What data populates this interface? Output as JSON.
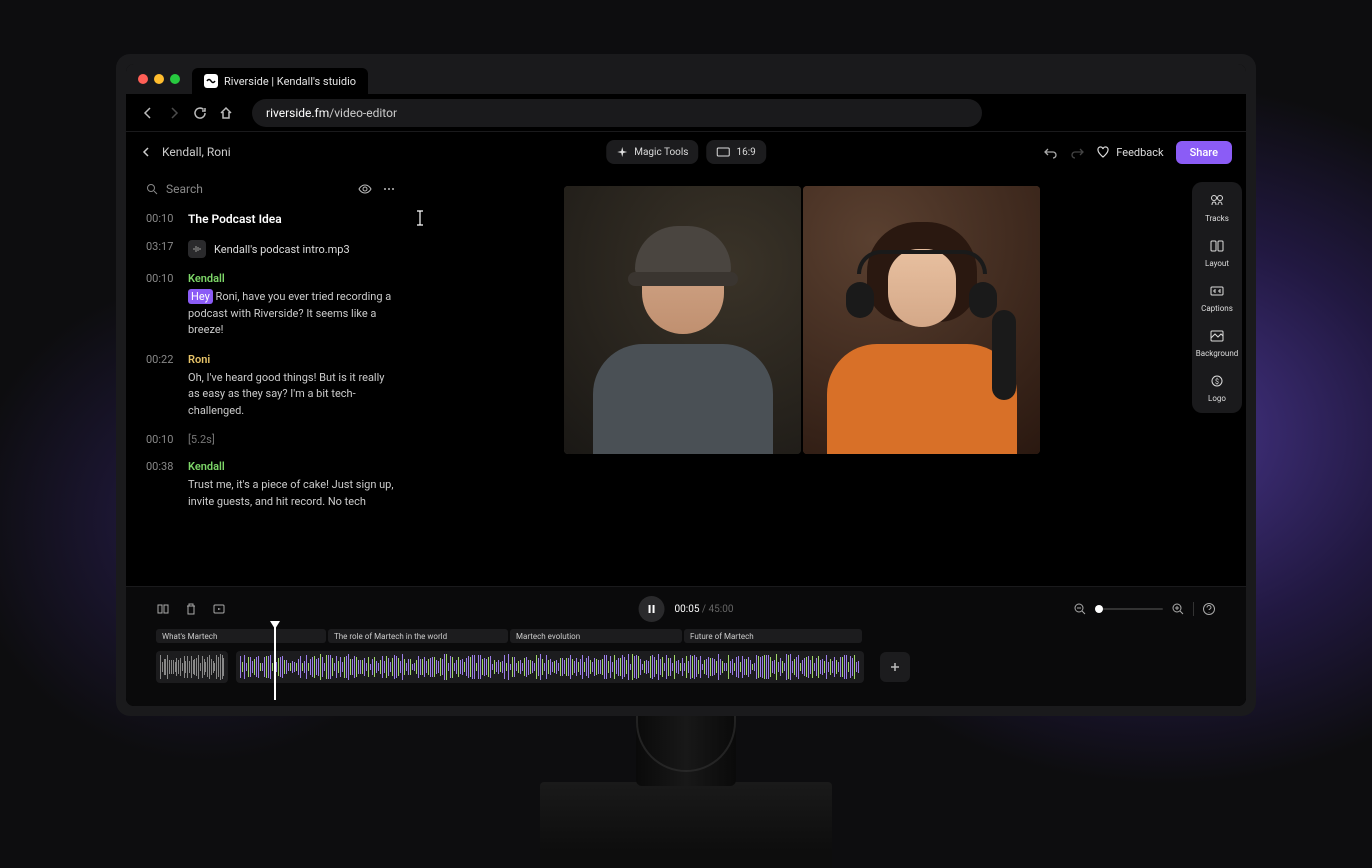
{
  "browser": {
    "tab_title": "Riverside | Kendall's stuidio",
    "url_domain": "riverside.fm",
    "url_path": "/video-editor"
  },
  "header": {
    "breadcrumb": "Kendall, Roni",
    "magic_tools": "Magic Tools",
    "aspect_ratio": "16:9",
    "feedback": "Feedback",
    "share": "Share"
  },
  "sidebar": {
    "items": [
      {
        "label": "Tracks"
      },
      {
        "label": "Layout"
      },
      {
        "label": "Captions"
      },
      {
        "label": "Background"
      },
      {
        "label": "Logo"
      }
    ]
  },
  "search": {
    "placeholder": "Search"
  },
  "transcript": [
    {
      "time": "00:10",
      "type": "title",
      "text": "The Podcast Idea"
    },
    {
      "time": "03:17",
      "type": "file",
      "text": "Kendall's podcast intro.mp3"
    },
    {
      "time": "00:10",
      "type": "speech",
      "speaker": "Kendall",
      "speaker_class": "green",
      "highlight": "Hey",
      "text": " Roni, have you ever tried recording a podcast with Riverside? It seems like a breeze!"
    },
    {
      "time": "00:22",
      "type": "speech",
      "speaker": "Roni",
      "speaker_class": "yellow",
      "text": "Oh, I've heard good things! But is it really as easy as they say? I'm a bit tech-challenged."
    },
    {
      "time": "00:10",
      "type": "gap",
      "text": "[5.2s]"
    },
    {
      "time": "00:38",
      "type": "speech",
      "speaker": "Kendall",
      "speaker_class": "green",
      "text": "Trust me, it's a piece of cake! Just sign up, invite guests, and hit record. No tech"
    }
  ],
  "playback": {
    "current_time": "00:05",
    "total_time": "45:00"
  },
  "timeline": {
    "chapters": [
      {
        "label": "What's Martech"
      },
      {
        "label": "The role of Martech in the world"
      },
      {
        "label": "Martech evolution"
      },
      {
        "label": "Future of Martech"
      }
    ]
  }
}
